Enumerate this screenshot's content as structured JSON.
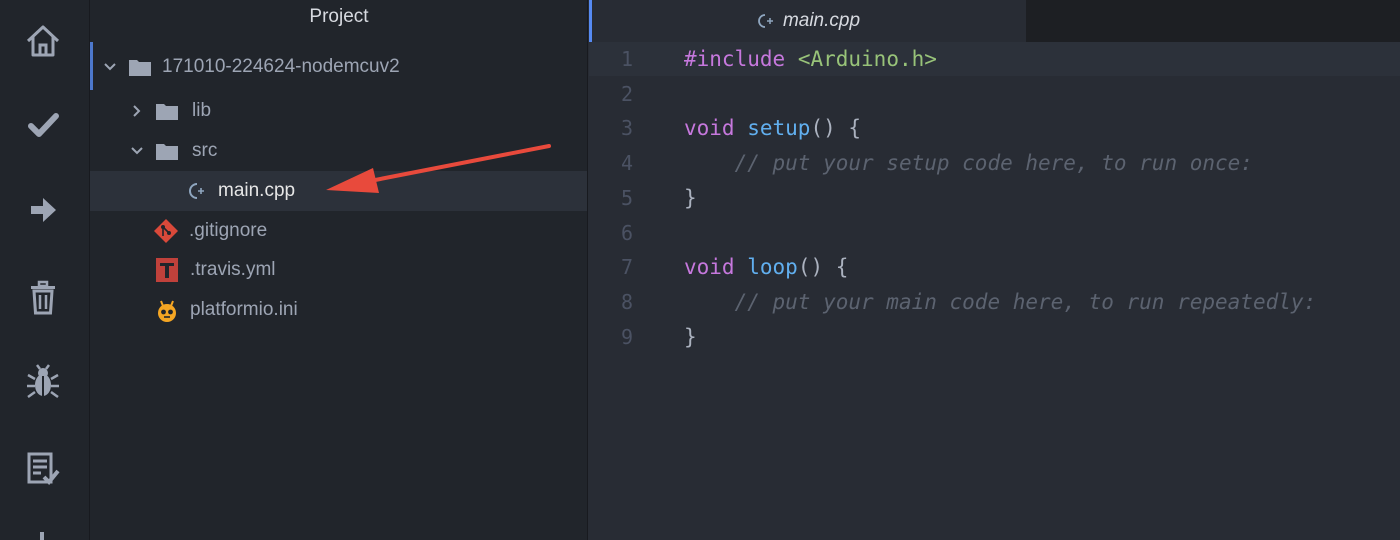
{
  "colors": {
    "arrow": "#e84a3c",
    "accent": "#568af2"
  },
  "activity_bar": {
    "items": [
      {
        "icon": "home-icon"
      },
      {
        "icon": "check-icon"
      },
      {
        "icon": "arrow-right-icon"
      },
      {
        "icon": "trash-icon"
      },
      {
        "icon": "bug-icon"
      },
      {
        "icon": "test-list-icon"
      }
    ]
  },
  "project": {
    "title": "Project",
    "root": "171010-224624-nodemcuv2",
    "items": [
      {
        "label": "lib",
        "icon": "folder-icon",
        "expanded": false
      },
      {
        "label": "src",
        "icon": "folder-icon",
        "expanded": true
      },
      {
        "label": "main.cpp",
        "icon": "cpp-file-icon",
        "selected": true
      },
      {
        "label": ".gitignore",
        "icon": "git-icon"
      },
      {
        "label": ".travis.yml",
        "icon": "travis-icon"
      },
      {
        "label": "platformio.ini",
        "icon": "platformio-icon"
      }
    ]
  },
  "editor": {
    "tab": {
      "label": "main.cpp",
      "icon": "cpp-file-icon"
    },
    "lines": [
      {
        "num": "1",
        "parts": [
          {
            "t": "#include",
            "c": "kw"
          },
          {
            "t": " "
          },
          {
            "t": "<Arduino.h>",
            "c": "str"
          }
        ]
      },
      {
        "num": "2",
        "parts": []
      },
      {
        "num": "3",
        "parts": [
          {
            "t": "void",
            "c": "kw"
          },
          {
            "t": " "
          },
          {
            "t": "setup",
            "c": "fn"
          },
          {
            "t": "() {"
          }
        ]
      },
      {
        "num": "4",
        "parts": [
          {
            "t": "    "
          },
          {
            "t": "// put your setup code here, to run once:",
            "c": "cm"
          }
        ]
      },
      {
        "num": "5",
        "parts": [
          {
            "t": "}"
          }
        ]
      },
      {
        "num": "6",
        "parts": []
      },
      {
        "num": "7",
        "parts": [
          {
            "t": "void",
            "c": "kw"
          },
          {
            "t": " "
          },
          {
            "t": "loop",
            "c": "fn"
          },
          {
            "t": "() {"
          }
        ]
      },
      {
        "num": "8",
        "parts": [
          {
            "t": "    "
          },
          {
            "t": "// put your main code here, to run repeatedly:",
            "c": "cm"
          }
        ]
      },
      {
        "num": "9",
        "parts": [
          {
            "t": "}"
          }
        ]
      }
    ]
  }
}
